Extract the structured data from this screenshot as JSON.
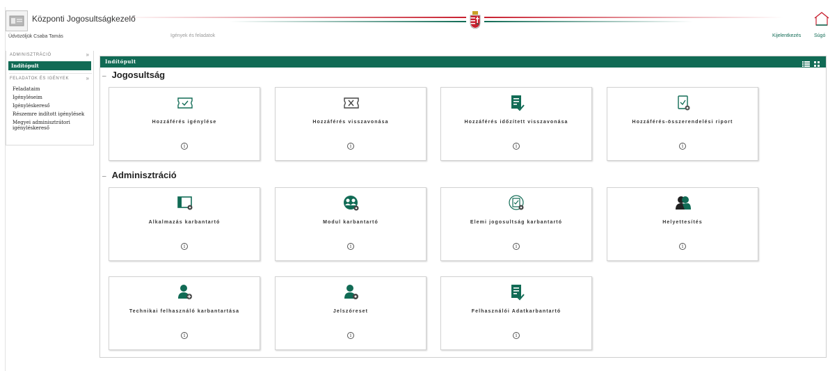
{
  "header": {
    "app_title": "Központi Jogosultságkezelő",
    "welcome": "Üdvözöljük Csaba Tamás",
    "nav_tasks": "Igények és feladatok",
    "logout": "Kijelentkezés",
    "help": "Súgó",
    "home_icon": "home-icon",
    "emblem": "hungarian-coat-of-arms"
  },
  "colors": {
    "brand_green": "#116b55",
    "stripe_red": "#c8202f",
    "stripe_green": "#116b55"
  },
  "sidebar": {
    "section_admin": "ADMINISZTRÁCIÓ",
    "active_item": "Indítópult",
    "section_tasks": "FELADATOK ÉS IGÉNYEK",
    "items": [
      "Feladataim",
      "Igényléseim",
      "Igényléskereső",
      "Részemre indított igénylések",
      "Megyei adminisztrátori igényléskereső"
    ]
  },
  "panel": {
    "title": "Indítópult",
    "view_icons": [
      "list-view-icon",
      "grid-view-icon"
    ]
  },
  "sections": [
    {
      "title": "Jogosultság",
      "tiles": [
        {
          "label": "Hozzáférés igénylése",
          "icon": "ticket-check-icon",
          "info": "i"
        },
        {
          "label": "Hozzáférés visszavonása",
          "icon": "ticket-x-icon",
          "info": "i"
        },
        {
          "label": "Hozzáférés időzített visszavonása",
          "icon": "document-check-icon",
          "info": "i"
        },
        {
          "label": "Hozzáférés-összerendelési riport",
          "icon": "clipboard-gear-icon",
          "info": "i"
        }
      ]
    },
    {
      "title": "Adminisztráció",
      "tiles": [
        {
          "label": "Alkalmazás karbantartó",
          "icon": "application-gear-icon",
          "info": "i"
        },
        {
          "label": "Modul karbantartó",
          "icon": "users-gear-icon",
          "info": "i"
        },
        {
          "label": "Elemi jogosultság karbantartó",
          "icon": "permission-gear-icon",
          "info": "i"
        },
        {
          "label": "Helyettesítés",
          "icon": "users-icon",
          "info": "i"
        },
        {
          "label": "Technikai felhasználó karbantartása",
          "icon": "user-add-icon",
          "info": "i"
        },
        {
          "label": "Jelszóreset",
          "icon": "user-gear-icon",
          "info": "i"
        },
        {
          "label": "Felhasználói Adatkarbantartó",
          "icon": "document-check-icon",
          "info": "i"
        }
      ]
    }
  ]
}
